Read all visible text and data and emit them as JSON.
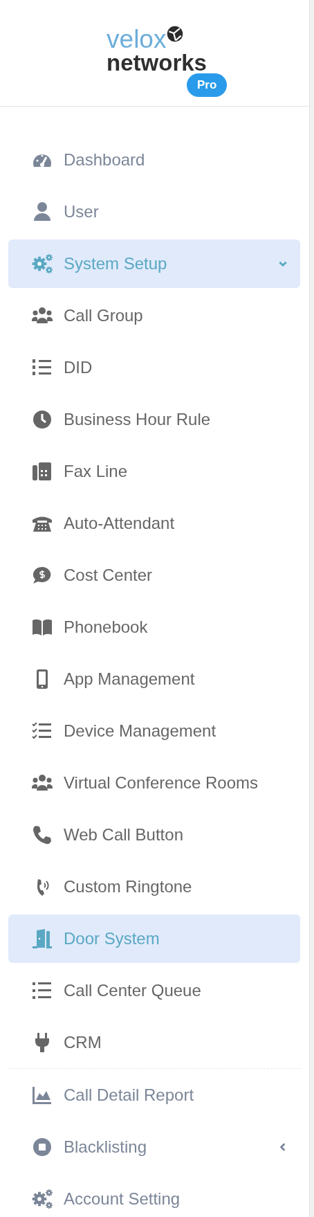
{
  "logo": {
    "line1": "velox",
    "line2": "networks",
    "badge": "Pro"
  },
  "menu": [
    {
      "label": "Dashboard",
      "selected": false
    },
    {
      "label": "User",
      "selected": false
    },
    {
      "label": "System Setup",
      "selected": true,
      "expanded": true,
      "children": [
        {
          "label": "Call Group",
          "selected": false
        },
        {
          "label": "DID",
          "selected": false
        },
        {
          "label": "Business Hour Rule",
          "selected": false
        },
        {
          "label": "Fax Line",
          "selected": false
        },
        {
          "label": "Auto-Attendant",
          "selected": false
        },
        {
          "label": "Cost Center",
          "selected": false
        },
        {
          "label": "Phonebook",
          "selected": false
        },
        {
          "label": "App Management",
          "selected": false
        },
        {
          "label": "Device Management",
          "selected": false
        },
        {
          "label": "Virtual Conference Rooms",
          "selected": false
        },
        {
          "label": "Web Call Button",
          "selected": false
        },
        {
          "label": "Custom Ringtone",
          "selected": false
        },
        {
          "label": "Door System",
          "selected": true
        },
        {
          "label": "Call Center Queue",
          "selected": false
        },
        {
          "label": "CRM",
          "selected": false
        }
      ]
    },
    {
      "label": "Call Detail Report",
      "selected": false
    },
    {
      "label": "Blacklisting",
      "selected": false,
      "expanded": false
    },
    {
      "label": "Account Setting",
      "selected": false
    }
  ]
}
